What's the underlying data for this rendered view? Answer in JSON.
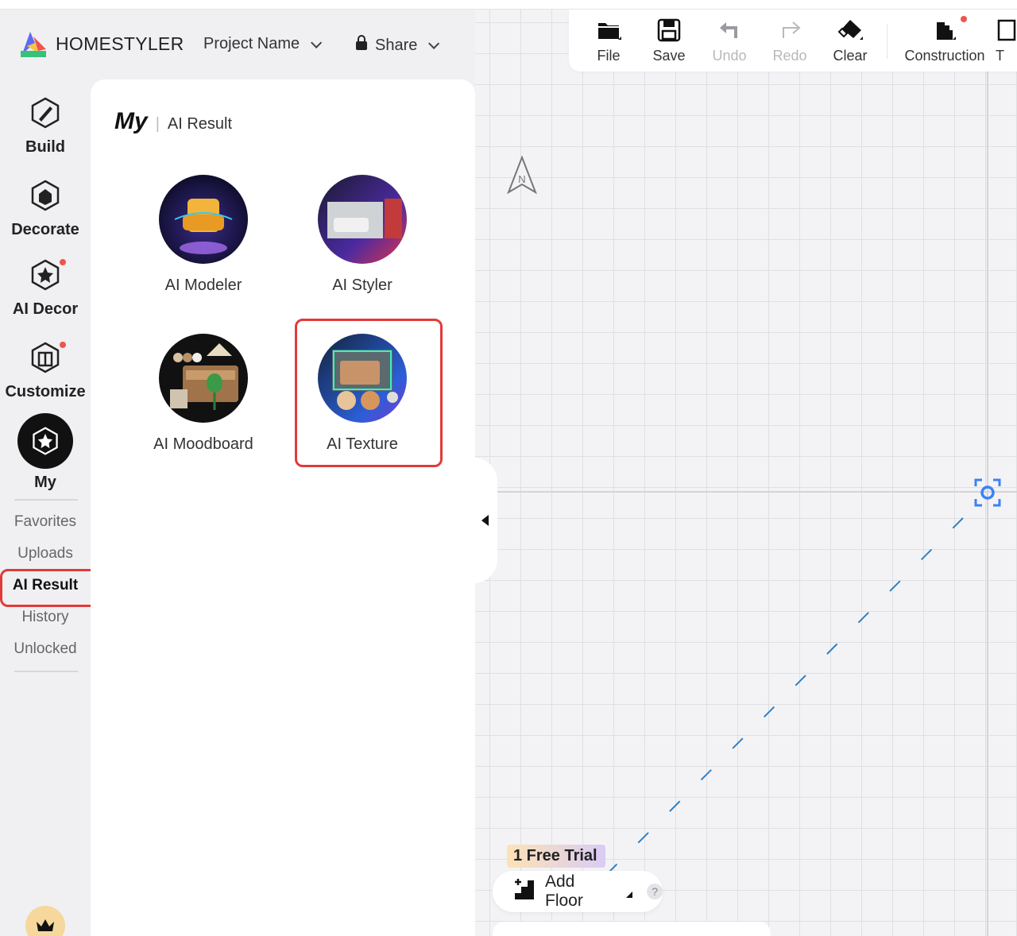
{
  "app": {
    "brand": "HOMESTYLER"
  },
  "header": {
    "project_name": "Project Name",
    "share": "Share"
  },
  "toolbar": {
    "file": "File",
    "save": "Save",
    "undo": "Undo",
    "redo": "Redo",
    "clear": "Clear",
    "construction": "Construction",
    "truncated": "T"
  },
  "sidebar": {
    "build": "Build",
    "decorate": "Decorate",
    "ai_decor": "AI Decor",
    "customize": "Customize",
    "my": "My",
    "sub": {
      "favorites": "Favorites",
      "uploads": "Uploads",
      "ai_result": "AI Result",
      "history": "History",
      "unlocked": "Unlocked"
    }
  },
  "panel": {
    "title": "My",
    "separator": "|",
    "subtitle": "AI Result",
    "tools": {
      "ai_modeler": "AI Modeler",
      "ai_styler": "AI Styler",
      "ai_moodboard": "AI Moodboard",
      "ai_texture": "AI Texture"
    }
  },
  "canvas": {
    "compass_label": "N",
    "free_trial": "1 Free Trial",
    "add_floor": "Add Floor",
    "help": "?"
  },
  "colors": {
    "highlight": "#e23a3a",
    "notification_dot": "#f0534f",
    "dashed_line": "#2f7fc4",
    "target_blue": "#3b82f6"
  }
}
